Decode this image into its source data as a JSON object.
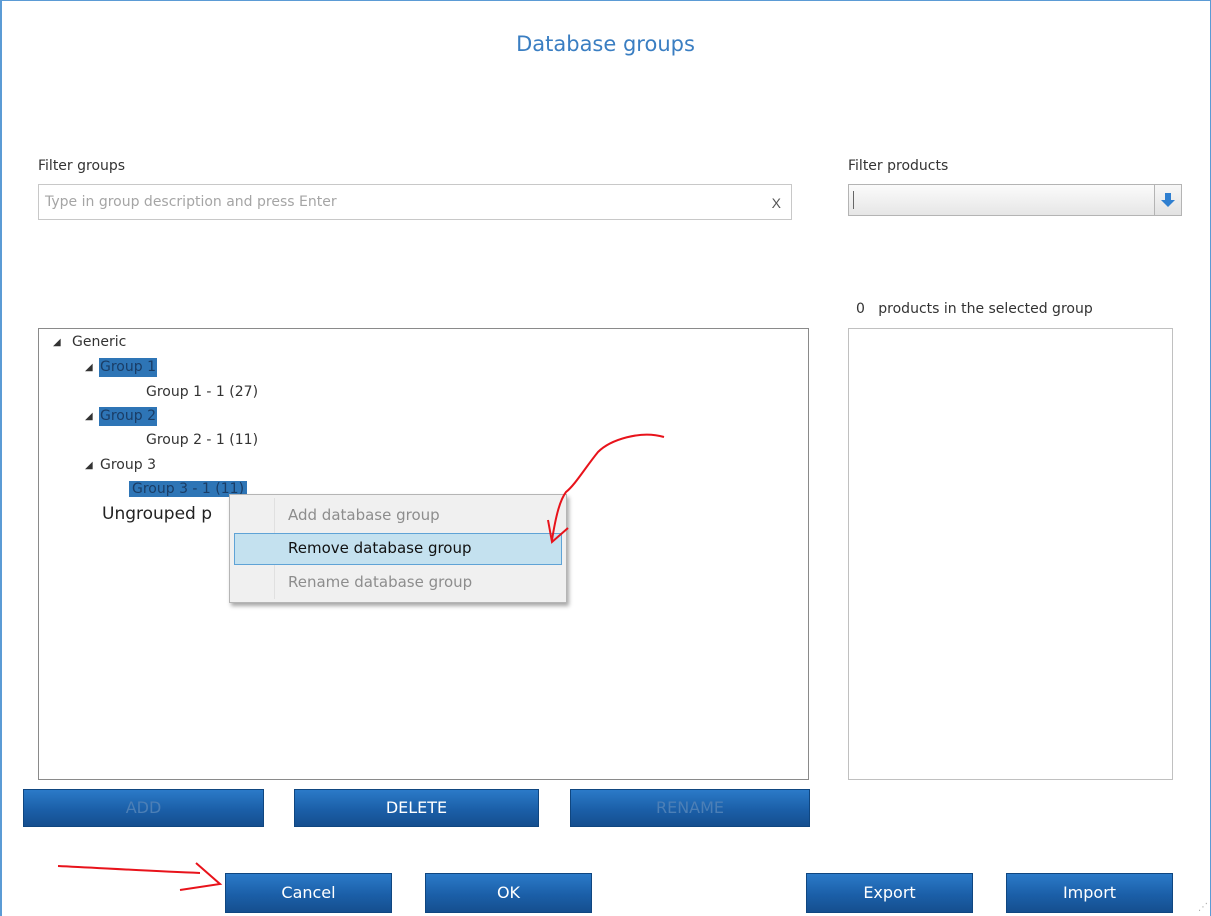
{
  "dialog": {
    "title": "Database groups"
  },
  "filter_groups": {
    "label": "Filter groups",
    "placeholder": "Type in group description and press Enter",
    "clear_label": "X"
  },
  "filter_products": {
    "label": "Filter products",
    "value": ""
  },
  "products_count": {
    "count": "0",
    "text": "products in the selected group"
  },
  "tree": {
    "root": "Generic",
    "group1": "Group 1",
    "group1_child": "Group 1 - 1 (27)",
    "group2": "Group 2",
    "group2_child": "Group 2 - 1 (11)",
    "group3": "Group 3",
    "group3_child": "Group 3 - 1 (11)",
    "ungrouped": "Ungrouped p"
  },
  "context_menu": {
    "items": [
      {
        "label": "Add database group",
        "state": "disabled"
      },
      {
        "label": "Remove database group",
        "state": "highlighted"
      },
      {
        "label": "Rename database group",
        "state": "disabled"
      }
    ]
  },
  "tree_buttons": {
    "add": "ADD",
    "delete": "DELETE",
    "rename": "RENAME"
  },
  "footer_buttons": {
    "cancel": "Cancel",
    "ok": "OK",
    "export": "Export",
    "import": "Import"
  },
  "colors": {
    "accent": "#3a7ec2",
    "selection": "#2e75b6",
    "button": "#1b5fa8",
    "menu_hover": "#c4e1ef",
    "annotation": "#e8131b"
  },
  "icons": {
    "expander": "triangle-down-icon",
    "combo_button": "blue-down-arrow-icon",
    "resize_grip": "resize-grip-icon"
  }
}
